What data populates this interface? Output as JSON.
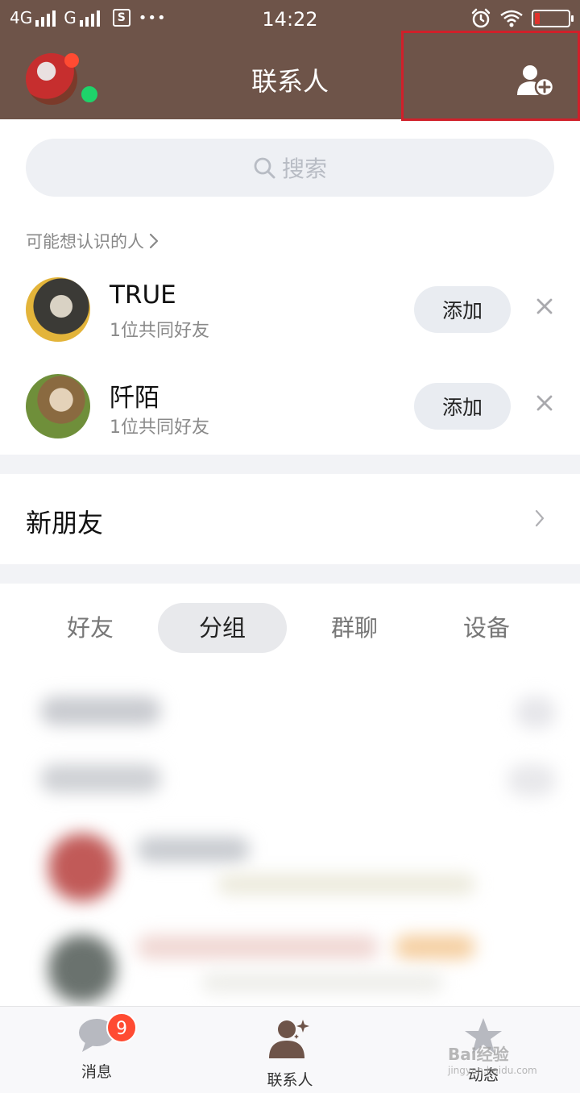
{
  "status_bar": {
    "network_1": "4G",
    "network_2": "G",
    "time": "14:22",
    "more": "•••",
    "s_icon": "S",
    "battery_color": "#e0322c"
  },
  "header": {
    "title": "联系人",
    "bg_color": "#6e5449",
    "highlight_color": "#d0202a"
  },
  "search": {
    "placeholder": "搜索"
  },
  "suggestions": {
    "title": "可能想认识的人",
    "people": [
      {
        "name": "TRUE",
        "mutual": "1位共同好友",
        "action": "添加"
      },
      {
        "name": "阡陌",
        "mutual": "1位共同好友",
        "action": "添加"
      }
    ]
  },
  "new_friends": {
    "label": "新朋友"
  },
  "tabs": [
    {
      "label": "好友",
      "active": false
    },
    {
      "label": "分组",
      "active": true
    },
    {
      "label": "群聊",
      "active": false
    },
    {
      "label": "设备",
      "active": false
    }
  ],
  "bottom_nav": {
    "items": [
      {
        "label": "消息",
        "icon": "chat-bubble-icon"
      },
      {
        "label": "联系人",
        "icon": "contact-person-icon"
      },
      {
        "label": "动态",
        "icon": "star-icon"
      }
    ],
    "badge": "9",
    "badge_color": "#ff4b32"
  },
  "watermark": {
    "text": "Bai经验",
    "url": "jingyan.baidu.com"
  }
}
